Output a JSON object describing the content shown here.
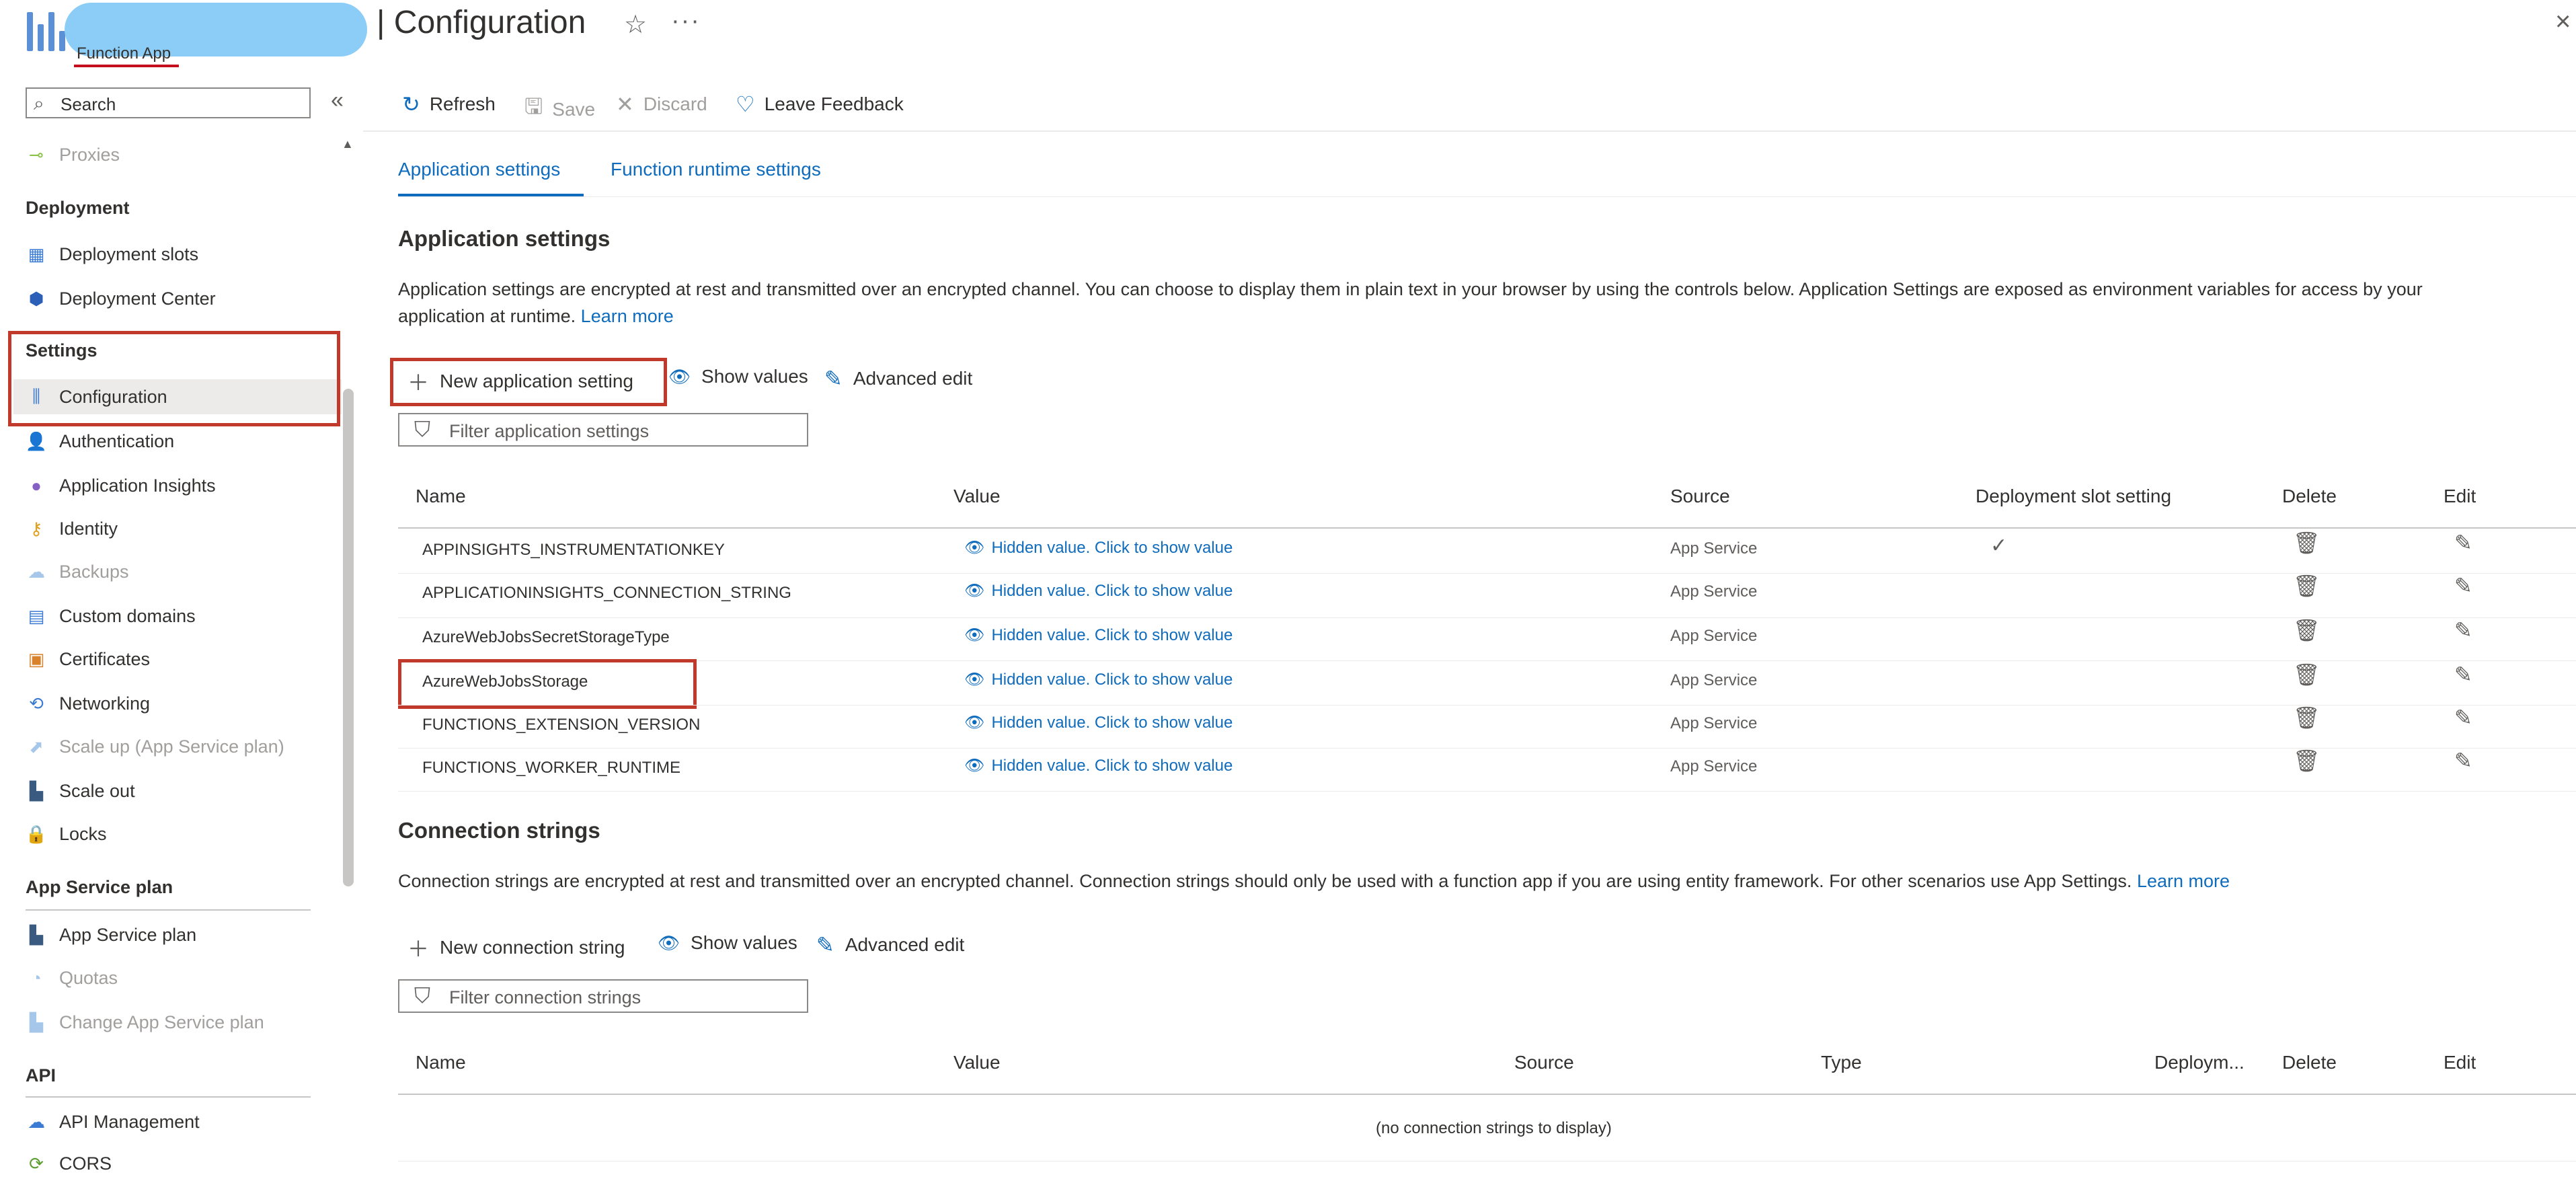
{
  "header": {
    "title": "| Configuration",
    "subtitle": "Function App",
    "star_icon": "star-icon",
    "more_icon": "ellipsis-icon",
    "close_icon": "close-icon"
  },
  "sidebar": {
    "search_placeholder": "Search",
    "collapse_glyph": "«",
    "items": [
      {
        "label": "Proxies",
        "icon": "proxies-icon",
        "disabled": true
      },
      {
        "section": "Deployment"
      },
      {
        "label": "Deployment slots",
        "icon": "deployment-slots-icon"
      },
      {
        "label": "Deployment Center",
        "icon": "deployment-center-icon"
      },
      {
        "section": "Settings"
      },
      {
        "label": "Configuration",
        "icon": "configuration-icon",
        "selected": true
      },
      {
        "label": "Authentication",
        "icon": "authentication-icon"
      },
      {
        "label": "Application Insights",
        "icon": "application-insights-icon"
      },
      {
        "label": "Identity",
        "icon": "identity-icon"
      },
      {
        "label": "Backups",
        "icon": "backups-icon",
        "disabled": true
      },
      {
        "label": "Custom domains",
        "icon": "custom-domains-icon"
      },
      {
        "label": "Certificates",
        "icon": "certificates-icon"
      },
      {
        "label": "Networking",
        "icon": "networking-icon"
      },
      {
        "label": "Scale up (App Service plan)",
        "icon": "scale-up-icon",
        "disabled": true
      },
      {
        "label": "Scale out",
        "icon": "scale-out-icon"
      },
      {
        "label": "Locks",
        "icon": "lock-icon"
      },
      {
        "section": "App Service plan"
      },
      {
        "label": "App Service plan",
        "icon": "app-service-plan-icon"
      },
      {
        "label": "Quotas",
        "icon": "quotas-icon",
        "disabled": true
      },
      {
        "label": "Change App Service plan",
        "icon": "change-plan-icon",
        "disabled": true
      },
      {
        "section": "API"
      },
      {
        "label": "API Management",
        "icon": "api-management-icon"
      },
      {
        "label": "CORS",
        "icon": "cors-icon"
      }
    ]
  },
  "toolbar": {
    "refresh": "Refresh",
    "save": "Save",
    "discard": "Discard",
    "feedback": "Leave Feedback"
  },
  "tabs": [
    "Application settings",
    "Function runtime settings"
  ],
  "app_settings": {
    "heading": "Application settings",
    "description_line1": "Application settings are encrypted at rest and transmitted over an encrypted channel. You can choose to display them in plain text in your browser by using the controls below. Application Settings are exposed as environment variables for access by your",
    "description_line2": "application at runtime.",
    "learn_more": "Learn more",
    "new_button": "New application setting",
    "show_values": "Show values",
    "advanced_edit": "Advanced edit",
    "filter_placeholder": "Filter application settings",
    "columns": [
      "Name",
      "Value",
      "Source",
      "Deployment slot setting",
      "Delete",
      "Edit"
    ],
    "hidden_value": "Hidden value. Click to show value",
    "rows": [
      {
        "name": "APPINSIGHTS_INSTRUMENTATIONKEY",
        "source": "App Service",
        "slot": true
      },
      {
        "name": "APPLICATIONINSIGHTS_CONNECTION_STRING",
        "source": "App Service",
        "slot": false
      },
      {
        "name": "AzureWebJobsSecretStorageType",
        "source": "App Service",
        "slot": false
      },
      {
        "name": "AzureWebJobsStorage",
        "source": "App Service",
        "slot": false
      },
      {
        "name": "FUNCTIONS_EXTENSION_VERSION",
        "source": "App Service",
        "slot": false
      },
      {
        "name": "FUNCTIONS_WORKER_RUNTIME",
        "source": "App Service",
        "slot": false
      }
    ]
  },
  "conn_strings": {
    "heading": "Connection strings",
    "description": "Connection strings are encrypted at rest and transmitted over an encrypted channel. Connection strings should only be used with a function app if you are using entity framework. For other scenarios use App Settings.",
    "learn_more": "Learn more",
    "new_button": "New connection string",
    "show_values": "Show values",
    "advanced_edit": "Advanced edit",
    "filter_placeholder": "Filter connection strings",
    "columns": [
      "Name",
      "Value",
      "Source",
      "Type",
      "Deploym...",
      "Delete",
      "Edit"
    ],
    "empty": "(no connection strings to display)"
  },
  "colors": {
    "accent": "#0f6cbd",
    "highlight_red": "#c0392b"
  }
}
